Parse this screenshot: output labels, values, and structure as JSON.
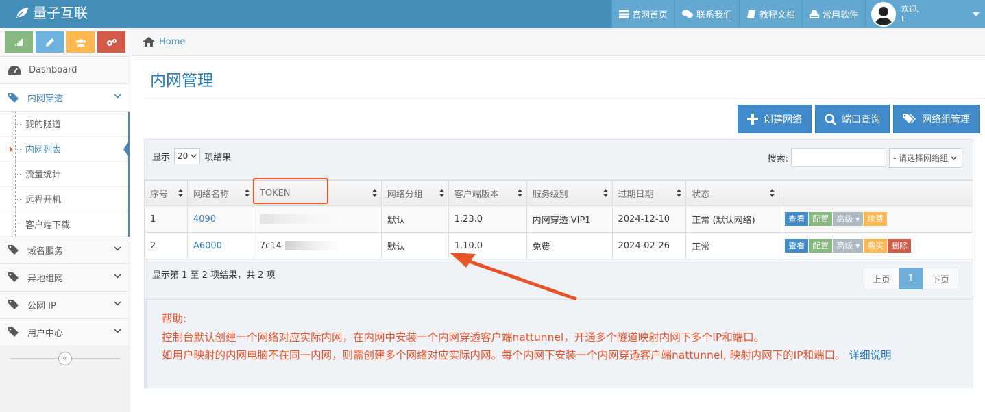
{
  "brand": {
    "name": "量子互联",
    "logo_icon": "leaf-icon"
  },
  "topnav": {
    "items": [
      {
        "label": "官网首页",
        "icon": "list-icon"
      },
      {
        "label": "联系我们",
        "icon": "chat-icon"
      },
      {
        "label": "教程文档",
        "icon": "book-icon"
      },
      {
        "label": "常用软件",
        "icon": "download-icon"
      }
    ],
    "user": {
      "greeting": "欢迎,",
      "name": "L"
    }
  },
  "sidebar": {
    "shortcuts": [
      {
        "icon": "signal-icon",
        "color": "#87b87f"
      },
      {
        "icon": "pencil-icon",
        "color": "#6fb3e0"
      },
      {
        "icon": "users-icon",
        "color": "#ffb752"
      },
      {
        "icon": "cogs-icon",
        "color": "#d15b47"
      }
    ],
    "dashboard": "Dashboard",
    "menu_open": "内网穿透",
    "submenu": [
      "我的隧道",
      "内网列表",
      "流量统计",
      "远程开机",
      "客户端下载"
    ],
    "menu_rest": [
      "域名服务",
      "异地组网",
      "公网 IP",
      "用户中心"
    ],
    "collapse_glyph": "«"
  },
  "breadcrumb": {
    "home": "Home"
  },
  "page": {
    "title": "内网管理"
  },
  "actions": [
    {
      "label": "创建网络",
      "icon": "plus-icon"
    },
    {
      "label": "端口查询",
      "icon": "search-icon"
    },
    {
      "label": "网络组管理",
      "icon": "tags-icon"
    }
  ],
  "table_controls": {
    "show_prefix": "显示",
    "page_length": "20",
    "show_suffix": "项结果",
    "search_label": "搜索:",
    "group_placeholder": "- 请选择网络组"
  },
  "columns": [
    "序号",
    "网络名称",
    "TOKEN",
    "网络分组",
    "客户端版本",
    "服务级别",
    "过期日期",
    "状态"
  ],
  "rows": [
    {
      "id": "1",
      "name": "4090",
      "token": "",
      "group": "默认",
      "version": "1.23.0",
      "level": "内网穿透 VIP1",
      "expire": "2024-12-10",
      "status": "正常 (默认网络)",
      "buttons": [
        "查看",
        "配置",
        "高级 ▾",
        "续费"
      ]
    },
    {
      "id": "2",
      "name": "A6000",
      "token": "7c14-",
      "group": "默认",
      "version": "1.10.0",
      "level": "免费",
      "expire": "2024-02-26",
      "status": "正常",
      "buttons": [
        "查看",
        "配置",
        "高级 ▾",
        "购买",
        "删除"
      ]
    }
  ],
  "table_footer": {
    "info": "显示第 1 至 2 项结果，共 2 项",
    "prev": "上页",
    "page": "1",
    "next": "下页"
  },
  "help": {
    "title": "帮助:",
    "line1": "控制台默认创建一个网络对应实际内网，在内网中安装一个内网穿透客户端nattunnel，开通多个隧道映射内网下多个IP和端口。",
    "line2": "如用户映射的内网电脑不在同一内网，则需创建多个网络对应实际内网。每个内网下安装一个内网穿透客户端nattunnel, 映射内网下的IP和端口。",
    "link": "详细说明"
  },
  "colors": {
    "topbar": "#438eb9",
    "accent": "#2679b5",
    "annotation": "#e8542a"
  }
}
